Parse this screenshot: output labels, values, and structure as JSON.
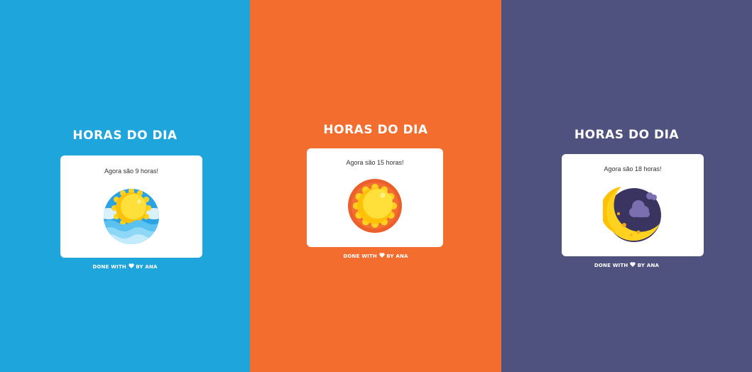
{
  "colors": {
    "morning": "#1ea5dc",
    "afternoon": "#f26d2e",
    "evening": "#4f517e",
    "card": "#ffffff"
  },
  "panels": [
    {
      "title": "HORAS DO DIA",
      "message": "Agora são 9 horas!",
      "illustration": "sun-over-sea-icon",
      "footer": {
        "before": "DONE WITH",
        "icon": "heart-icon",
        "after": "BY ANA"
      }
    },
    {
      "title": "HORAS DO DIA",
      "message": "Agora são 15 horas!",
      "illustration": "sun-icon",
      "footer": {
        "before": "DONE WITH",
        "icon": "heart-icon",
        "after": "BY ANA"
      }
    },
    {
      "title": "HORAS DO DIA",
      "message": "Agora são 18 horas!",
      "illustration": "moon-cloud-icon",
      "footer": {
        "before": "DONE WITH",
        "icon": "heart-icon",
        "after": "BY ANA"
      }
    }
  ]
}
